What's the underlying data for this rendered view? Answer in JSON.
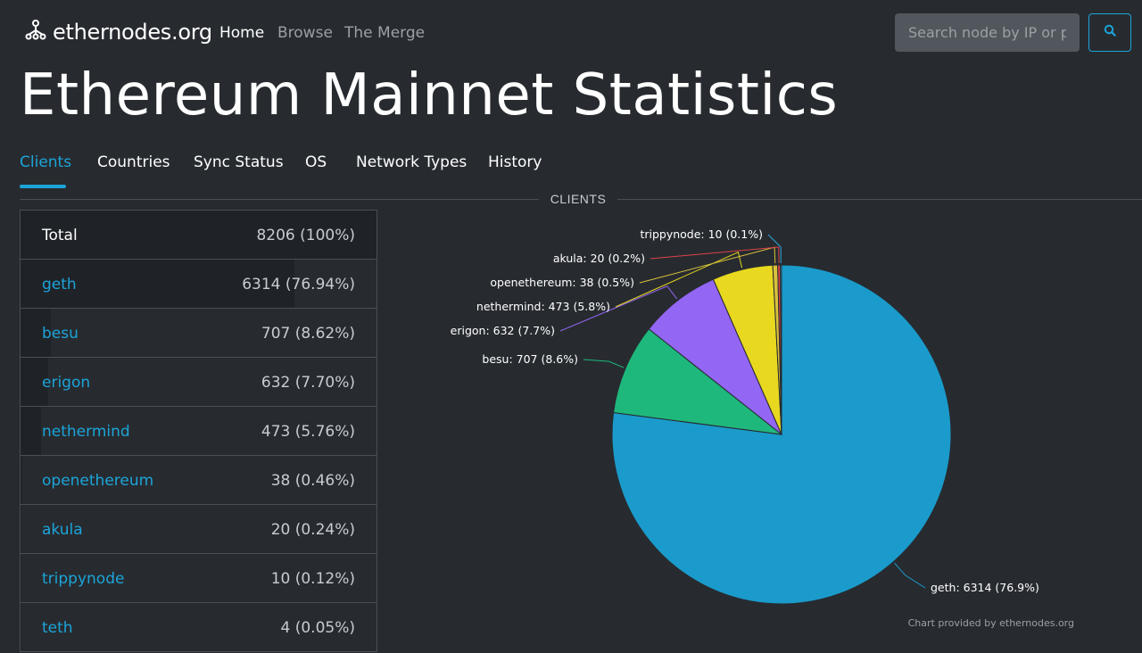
{
  "brand": {
    "name": "ethernodes.org"
  },
  "nav": {
    "home": "Home",
    "browse": "Browse",
    "merge": "The Merge"
  },
  "search": {
    "placeholder": "Search node by IP or pu"
  },
  "page": {
    "title": "Ethereum Mainnet Statistics"
  },
  "tabs": [
    "Clients",
    "Countries",
    "Sync Status",
    "OS",
    "Network Types",
    "History"
  ],
  "active_tab": "Clients",
  "section": {
    "label": "CLIENTS"
  },
  "table": {
    "total": {
      "label": "Total",
      "value": "8206 (100%)"
    },
    "rows": [
      {
        "name": "geth",
        "value": "6314 (76.94%)"
      },
      {
        "name": "besu",
        "value": "707 (8.62%)"
      },
      {
        "name": "erigon",
        "value": "632 (7.70%)"
      },
      {
        "name": "nethermind",
        "value": "473 (5.76%)"
      },
      {
        "name": "openethereum",
        "value": "38 (0.46%)"
      },
      {
        "name": "akula",
        "value": "20 (0.24%)"
      },
      {
        "name": "trippynode",
        "value": "10 (0.12%)"
      },
      {
        "name": "teth",
        "value": "4 (0.05%)"
      }
    ]
  },
  "chart_data": {
    "type": "pie",
    "title": "CLIENTS",
    "slices": [
      {
        "name": "geth",
        "value": 6314,
        "label": "geth: 6314 (76.9%)",
        "color": "#1a9bcb"
      },
      {
        "name": "besu",
        "value": 707,
        "label": "besu: 707 (8.6%)",
        "color": "#1fb87c"
      },
      {
        "name": "erigon",
        "value": 632,
        "label": "erigon: 632 (7.7%)",
        "color": "#9366f3"
      },
      {
        "name": "nethermind",
        "value": 473,
        "label": "nethermind: 473 (5.8%)",
        "color": "#e8d81f"
      },
      {
        "name": "openethereum",
        "value": 38,
        "label": "openethereum: 38 (0.5%)",
        "color": "#d9c23b"
      },
      {
        "name": "akula",
        "value": 20,
        "label": "akula: 20 (0.2%)",
        "color": "#e0424b"
      },
      {
        "name": "trippynode",
        "value": 10,
        "label": "trippynode: 10 (0.1%)",
        "color": "#2ba6d9"
      }
    ],
    "credit": "Chart provided by ethernodes.org"
  }
}
